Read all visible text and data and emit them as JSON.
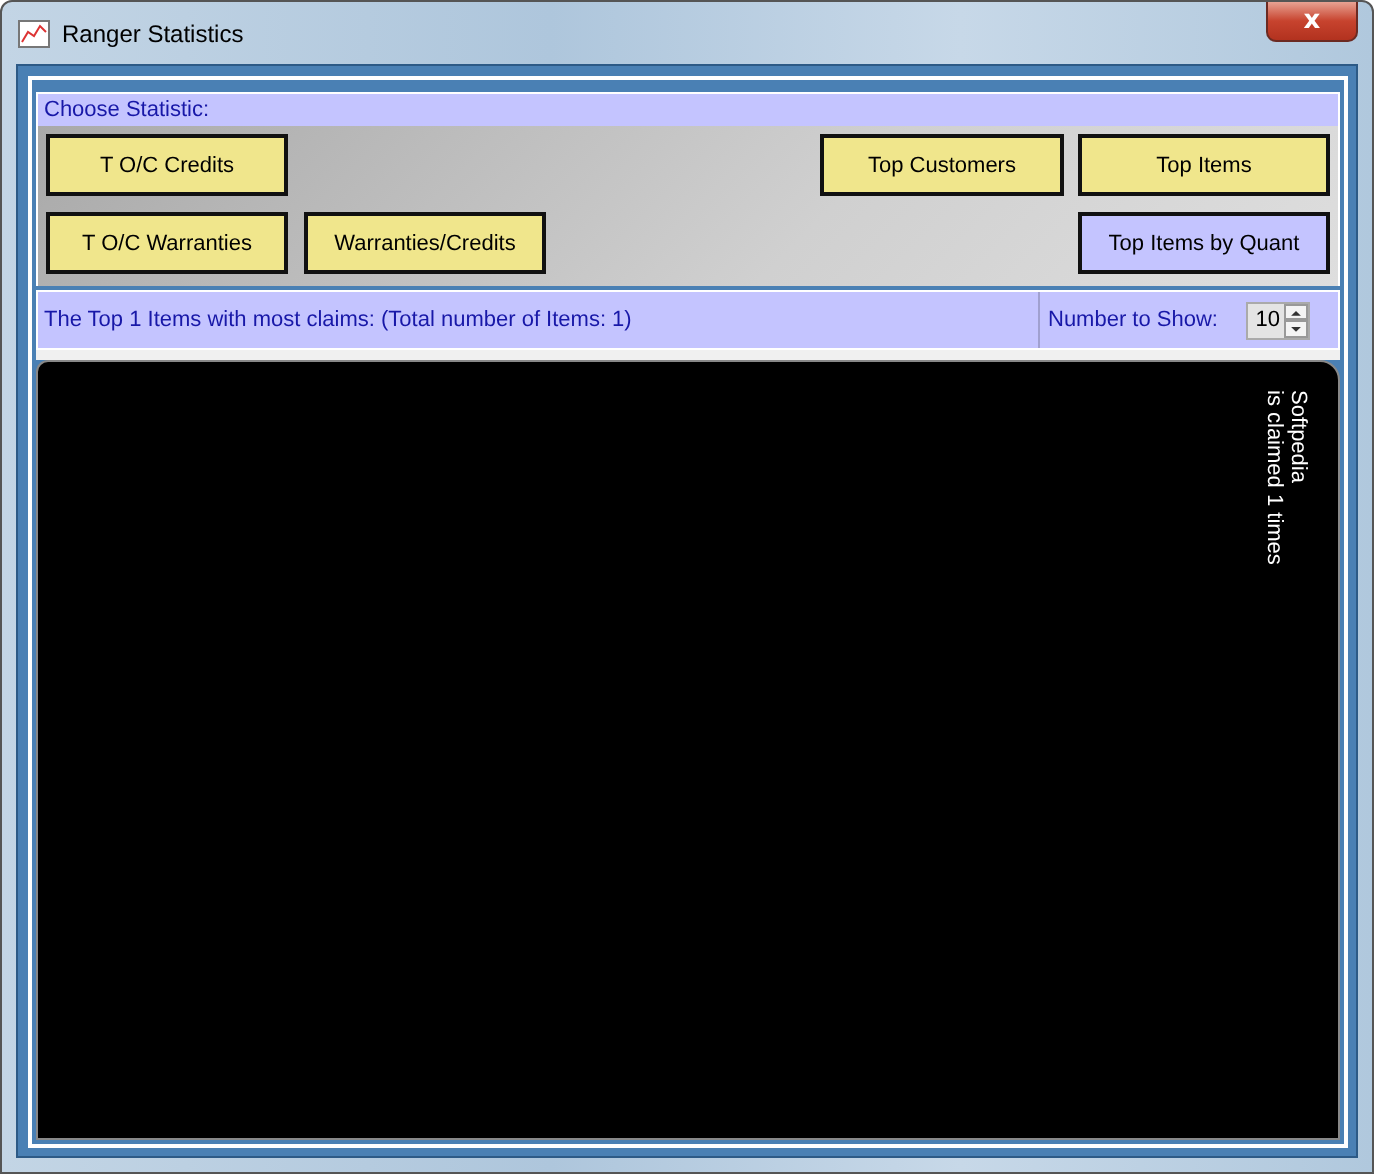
{
  "window": {
    "title": "Ranger Statistics",
    "close": "x"
  },
  "choose_label": "Choose Statistic:",
  "buttons_left": [
    {
      "label": "T O/C Credits",
      "selected": false
    },
    {
      "label": "T O/C Warranties",
      "selected": false
    },
    {
      "label": "Warranties/Credits",
      "selected": false
    }
  ],
  "buttons_right": [
    {
      "label": "Top Customers",
      "selected": false
    },
    {
      "label": "Top Items",
      "selected": false
    },
    {
      "label": "Top Items by Quant",
      "selected": true
    }
  ],
  "status": {
    "message": "The Top 1 Items with most claims: (Total number of Items: 1)",
    "number_label": "Number to Show:",
    "number_value": "10"
  },
  "display": {
    "lines": [
      "Softpedia",
      "is claimed 1 times"
    ]
  }
}
